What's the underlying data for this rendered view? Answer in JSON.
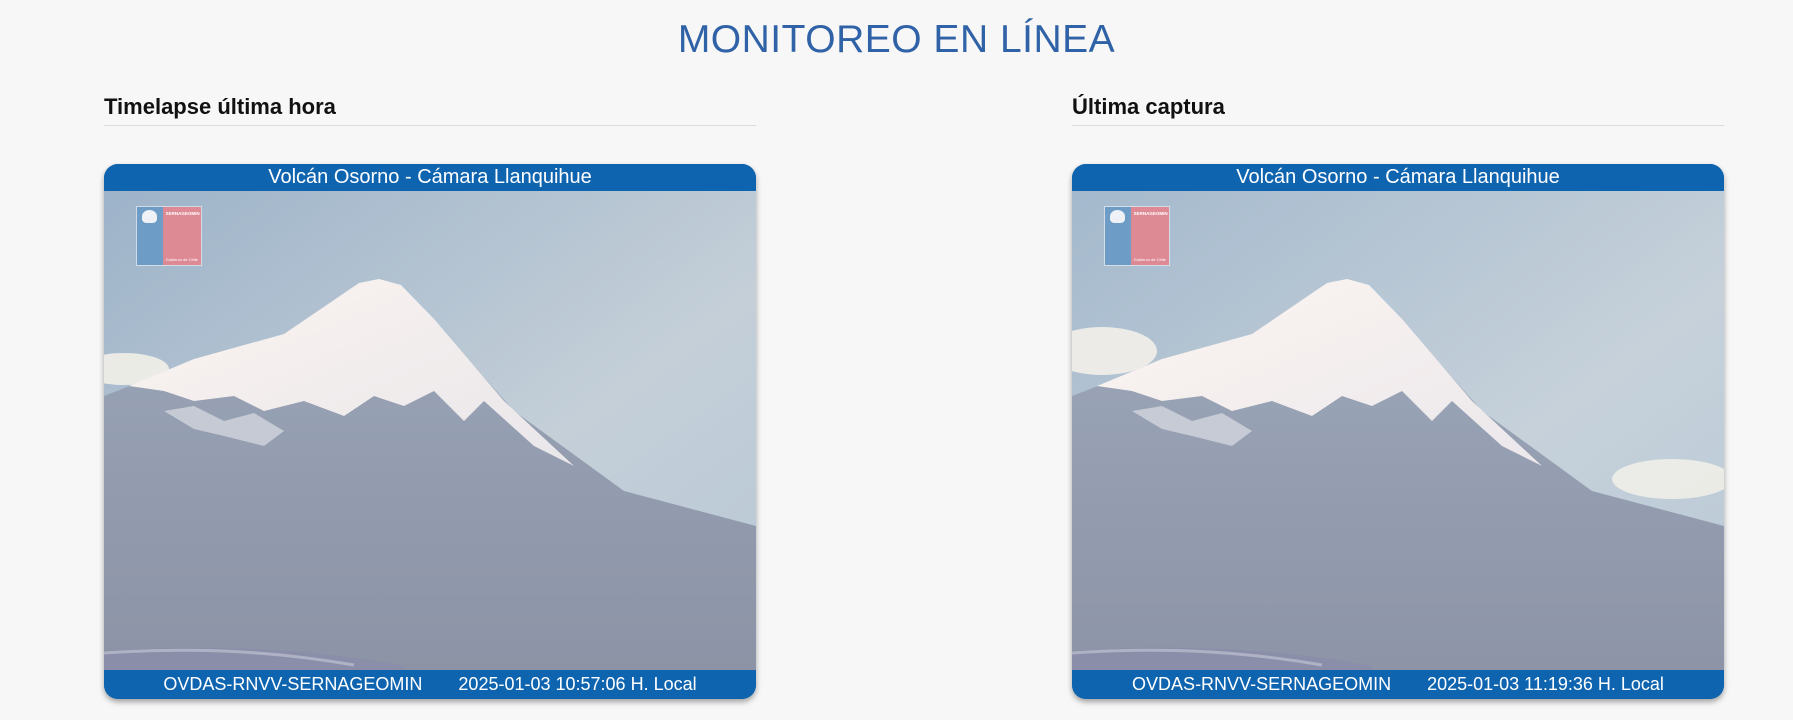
{
  "page": {
    "title": "MONITOREO EN LÍNEA"
  },
  "sections": [
    {
      "heading": "Timelapse última hora",
      "camera": {
        "title": "Volcán Osorno - Cámara Llanquihue",
        "source": "OVDAS-RNVV-SERNAGEOMIN",
        "timestamp": "2025-01-03 10:57:06 H. Local",
        "logo": {
          "org": "SERNAGEOMIN",
          "sub": "Ministerio de Minería",
          "gov": "Gobierno de Chile"
        }
      }
    },
    {
      "heading": "Última captura",
      "camera": {
        "title": "Volcán Osorno - Cámara Llanquihue",
        "source": "OVDAS-RNVV-SERNAGEOMIN",
        "timestamp": "2025-01-03 11:19:36 H. Local",
        "logo": {
          "org": "SERNAGEOMIN",
          "sub": "Ministerio de Minería",
          "gov": "Gobierno de Chile"
        }
      }
    }
  ],
  "colors": {
    "accent": "#2f62a6",
    "camera_bar": "#0f64b0",
    "background": "#f7f7f7"
  },
  "icons": {
    "logo": "gobierno-de-chile-logo-icon"
  }
}
